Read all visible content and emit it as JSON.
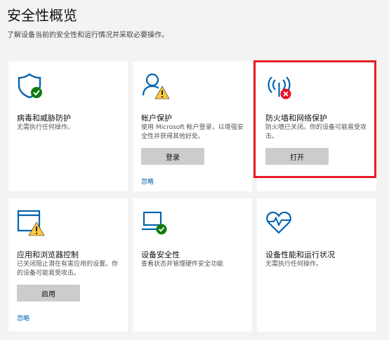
{
  "header": {
    "title": "安全性概览",
    "subtitle": "了解设备当前的安全性和运行情况并采取必要操作。"
  },
  "colors": {
    "accent": "#0063b1",
    "ok": "#107c10",
    "warn": "#ffc83d",
    "error": "#e81123",
    "highlight": "#e81c24"
  },
  "tiles": [
    {
      "title": "病毒和威胁防护",
      "desc": "无需执行任何操作。",
      "icon": "shield-check-icon"
    },
    {
      "title": "帐户保护",
      "desc": "使用 Microsoft 帐户登录，以增强安全性并获得其他好处。",
      "icon": "person-warning-icon",
      "button": "登录",
      "link": "忽略"
    },
    {
      "title": "防火墙和网络保护",
      "desc": "防火墙已关闭。你的设备可能易受攻击。",
      "icon": "antenna-error-icon",
      "button": "打开"
    },
    {
      "title": "应用和浏览器控制",
      "desc": "已关闭阻止潜在有害应用的设置。你的设备可能易受攻击。",
      "icon": "browser-warning-icon",
      "button": "启用",
      "link": "忽略"
    },
    {
      "title": "设备安全性",
      "desc": "查看状态并管理硬件安全功能",
      "icon": "laptop-check-icon"
    },
    {
      "title": "设备性能和运行状况",
      "desc": "无需执行任何操作。",
      "icon": "heart-health-icon"
    }
  ]
}
